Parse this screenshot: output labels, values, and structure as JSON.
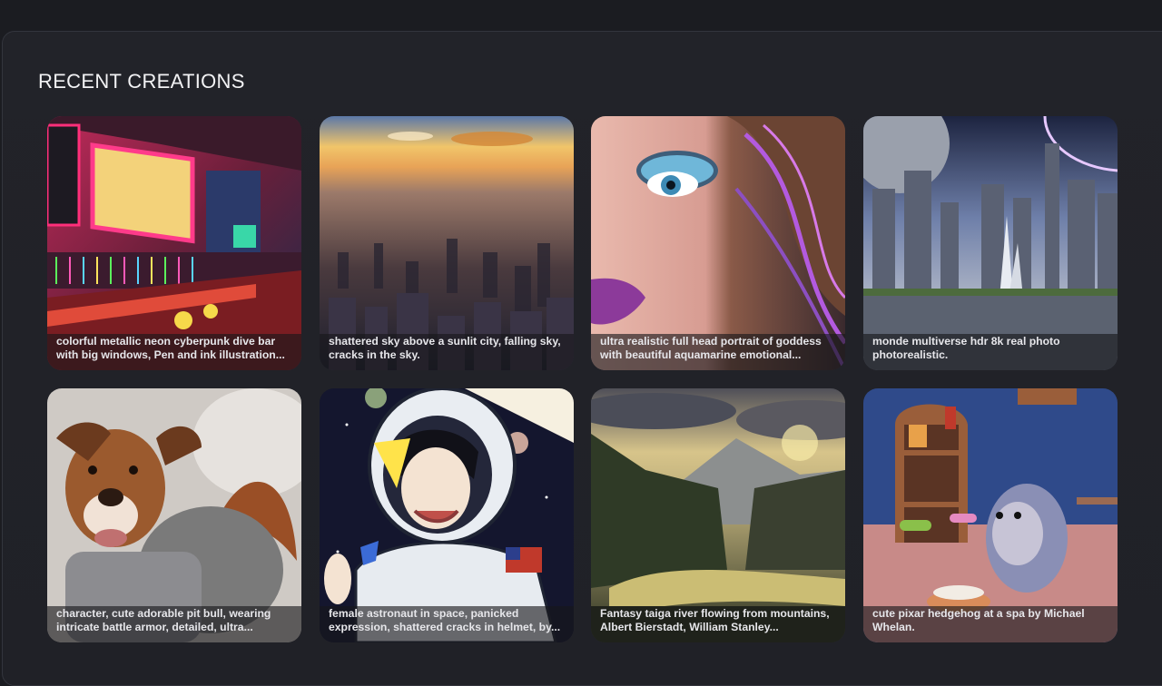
{
  "section": {
    "title": "RECENT CREATIONS"
  },
  "creations": [
    {
      "caption": "colorful metallic neon cyberpunk dive bar with big windows, Pen and ink illustration...",
      "subject": "neon-bar"
    },
    {
      "caption": "shattered sky above a sunlit city, falling sky, cracks in the sky.",
      "subject": "city"
    },
    {
      "caption": "ultra realistic full head portrait of goddess with beautiful aquamarine emotional...",
      "subject": "portrait"
    },
    {
      "caption": "monde multiverse hdr 8k real photo photorealistic.",
      "subject": "futuristic-city"
    },
    {
      "caption": "character, cute adorable pit bull, wearing intricate battle armor, detailed, ultra...",
      "subject": "pitbull"
    },
    {
      "caption": "female astronaut in space, panicked expression, shattered cracks in helmet, by...",
      "subject": "astronaut"
    },
    {
      "caption": "Fantasy taiga river flowing from mountains, Albert Bierstadt, William Stanley...",
      "subject": "landscape"
    },
    {
      "caption": "cute pixar hedgehog at a spa by Michael Whelan.",
      "subject": "hedgehog"
    }
  ]
}
